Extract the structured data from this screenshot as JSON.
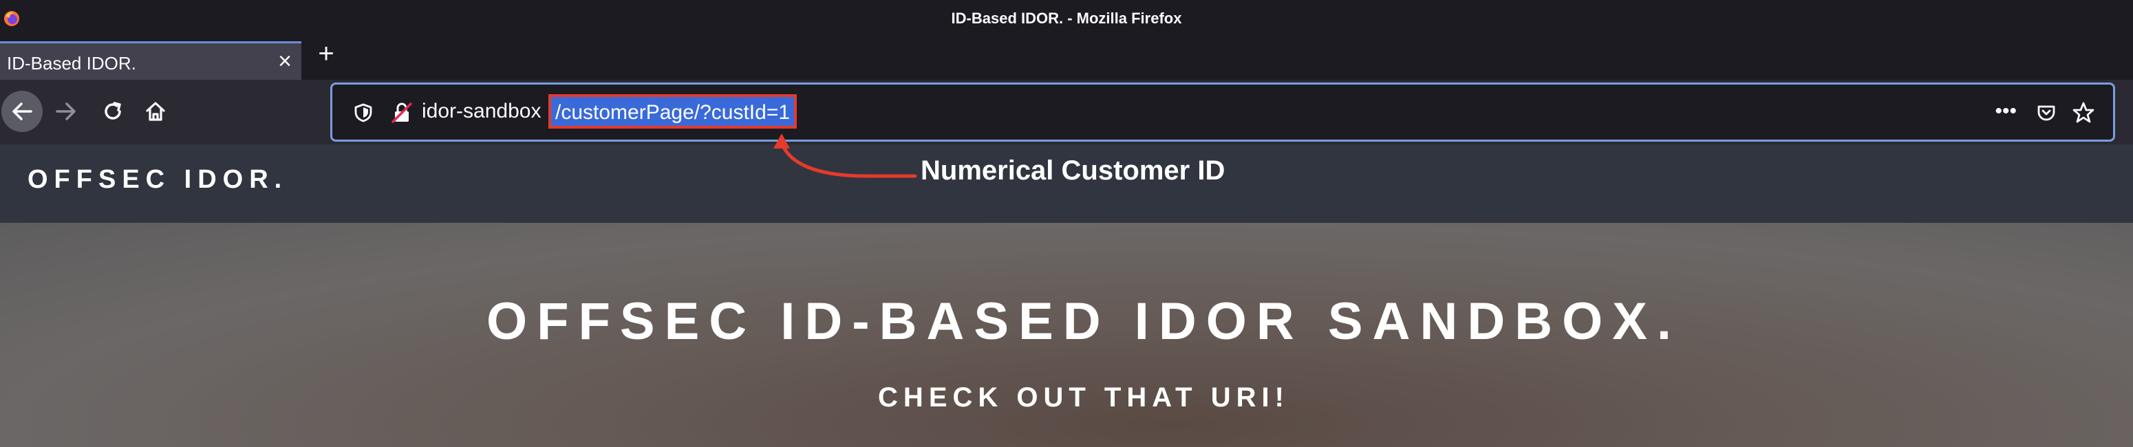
{
  "window": {
    "title": "ID-Based IDOR. - Mozilla Firefox"
  },
  "tabs": [
    {
      "label": "ID-Based IDOR.",
      "active": true
    }
  ],
  "toolbar": {
    "new_tab_label": "+",
    "close_tab_label": "×"
  },
  "urlbar": {
    "host": "idor-sandbox",
    "path": "/customerPage/?custId=1",
    "more_label": "•••"
  },
  "annotation": {
    "text": "Numerical Customer ID",
    "color": "#e53a2c"
  },
  "site": {
    "brand": "OFFSEC IDOR.",
    "hero_title": "OFFSEC ID-BASED IDOR SANDBOX.",
    "hero_subtitle": "CHECK OUT THAT URI!"
  },
  "icons": {
    "app": "firefox-icon",
    "back": "arrow-left-icon",
    "forward": "arrow-right-icon",
    "reload": "reload-icon",
    "home": "home-icon",
    "shield": "shield-icon",
    "insecure": "insecure-lock-icon",
    "pocket": "pocket-icon",
    "bookmark": "star-icon"
  }
}
